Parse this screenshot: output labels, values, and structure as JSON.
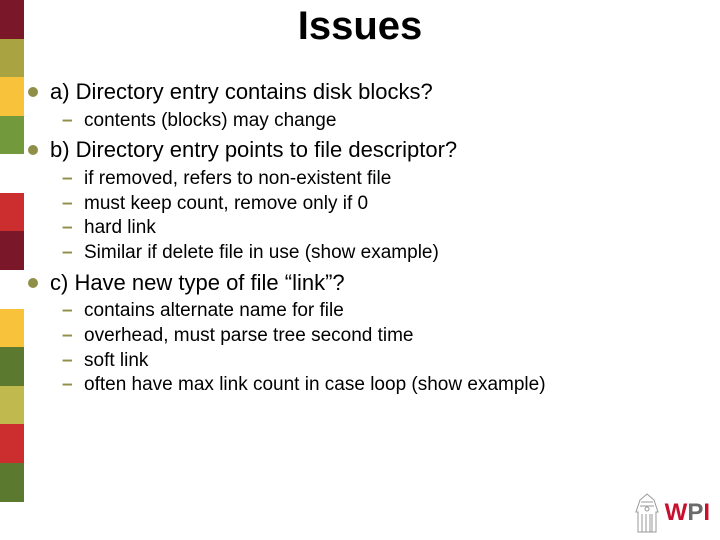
{
  "title": "Issues",
  "points": {
    "a": {
      "text": "a) Directory entry contains disk blocks?",
      "subs": [
        "contents (blocks) may change"
      ]
    },
    "b": {
      "text": "b) Directory entry points to file descriptor?",
      "subs": [
        "if removed, refers to non-existent file",
        "must keep count, remove only if 0",
        "hard link",
        "Similar if delete file in use (show example)"
      ]
    },
    "c": {
      "text": "c) Have new type of file “link”?",
      "subs": [
        "contains alternate name for file",
        "overhead, must parse tree second time",
        "soft link",
        "often have max link count in case loop (show example)"
      ]
    }
  },
  "logo": {
    "w": "W",
    "p": "P",
    "i": "I"
  }
}
